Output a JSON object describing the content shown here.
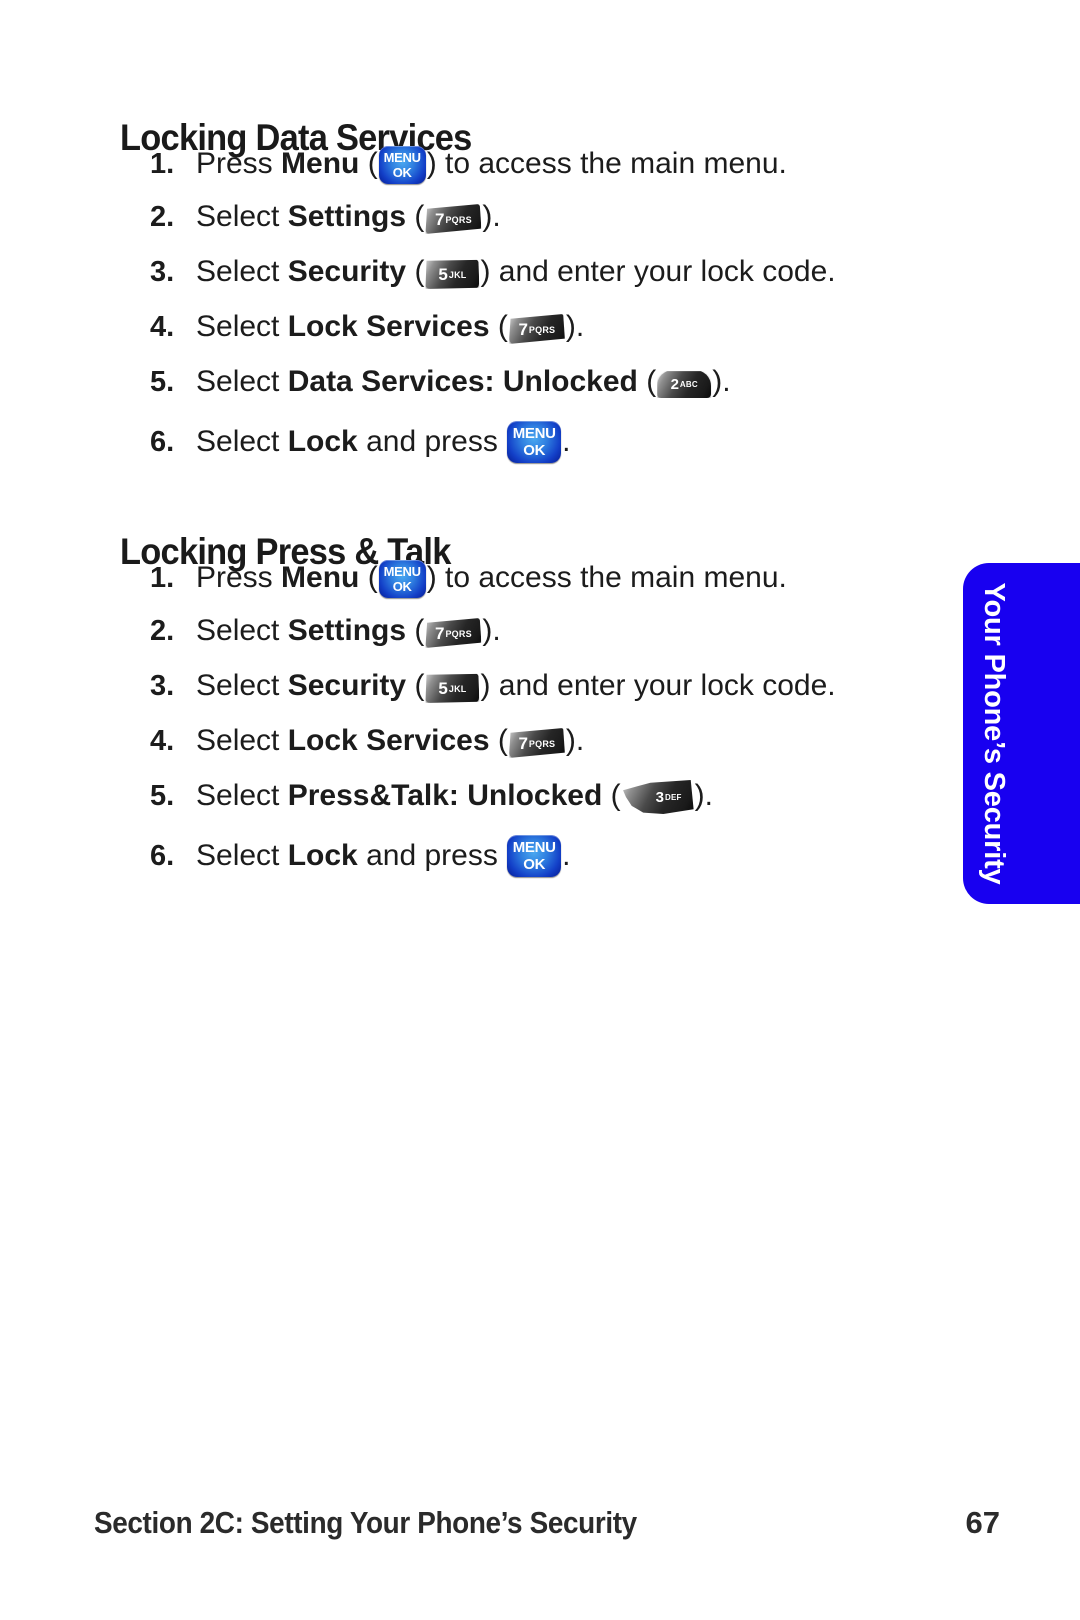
{
  "page": {
    "number": "67",
    "footer_title": "Section 2C: Setting Your Phone’s Security"
  },
  "side_tab": {
    "label": "Your Phone’s Security",
    "color": "#1800f0",
    "text_color": "#ffffff"
  },
  "sections": [
    {
      "heading": "Locking Data Services",
      "steps": [
        {
          "number": "1.",
          "pre": "Press ",
          "bold": "Menu",
          "mid": " (",
          "key": "menu-ok",
          "post": ") to access the main menu."
        },
        {
          "number": "2.",
          "pre": "Select ",
          "bold": "Settings",
          "mid": " (",
          "key": "7-pqrs",
          "post": ")."
        },
        {
          "number": "3.",
          "pre": "Select ",
          "bold": "Security",
          "mid": " (",
          "key": "5-jkl",
          "post": ") and enter your lock code."
        },
        {
          "number": "4.",
          "pre": "Select ",
          "bold": "Lock Services",
          "mid": " (",
          "key": "7-pqrs",
          "post": ")."
        },
        {
          "number": "5.",
          "pre": "Select ",
          "bold": "Data Services: Unlocked",
          "mid": " (",
          "key": "2-abc",
          "post": ")."
        },
        {
          "number": "6.",
          "pre": "Select ",
          "bold": "Lock",
          "mid": " and press ",
          "key": "menu-ok-large",
          "post": "."
        }
      ]
    },
    {
      "heading": "Locking Press & Talk",
      "steps": [
        {
          "number": "1.",
          "pre": "Press ",
          "bold": "Menu",
          "mid": " (",
          "key": "menu-ok",
          "post": ") to access the main menu."
        },
        {
          "number": "2.",
          "pre": "Select ",
          "bold": "Settings",
          "mid": " (",
          "key": "7-pqrs",
          "post": ")."
        },
        {
          "number": "3.",
          "pre": "Select ",
          "bold": "Security",
          "mid": " (",
          "key": "5-jkl",
          "post": ") and enter your lock code."
        },
        {
          "number": "4.",
          "pre": "Select ",
          "bold": "Lock Services",
          "mid": " (",
          "key": "7-pqrs",
          "post": ")."
        },
        {
          "number": "5.",
          "pre": "Select ",
          "bold": "Press&Talk: Unlocked",
          "mid": " (",
          "key": "3-def",
          "post": ")."
        },
        {
          "number": "6.",
          "pre": "Select ",
          "bold": "Lock",
          "mid": " and press ",
          "key": "menu-ok-large",
          "post": "."
        }
      ]
    }
  ],
  "keys": {
    "menu-ok": {
      "line1": "MENU",
      "line2": "OK"
    },
    "menu-ok-large": {
      "line1": "MENU",
      "line2": "OK"
    },
    "7-pqrs": {
      "digit": "7",
      "alpha": "PQRS"
    },
    "5-jkl": {
      "digit": "5",
      "alpha": "JKL"
    },
    "2-abc": {
      "digit": "2",
      "alpha": "ABC"
    },
    "3-def": {
      "digit": "3",
      "alpha": "DEF"
    }
  }
}
